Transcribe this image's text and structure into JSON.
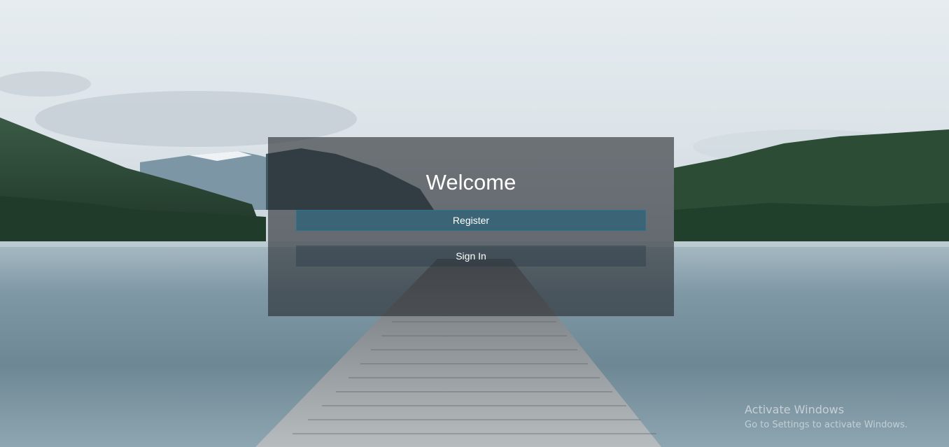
{
  "welcome_card": {
    "title": "Welcome",
    "register_label": "Register",
    "signin_label": "Sign In"
  },
  "os_watermark": {
    "title": "Activate Windows",
    "subtitle": "Go to Settings to activate Windows."
  },
  "colors": {
    "panel_overlay": "#2b2f34",
    "register_button": "#175e7a",
    "text": "#ffffff"
  }
}
